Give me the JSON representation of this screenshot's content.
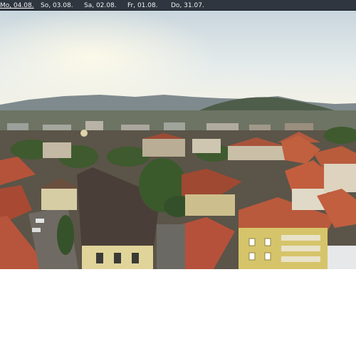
{
  "archive_bar": {
    "days": [
      {
        "label": "Mo, 04.08."
      },
      {
        "label": "So, 03.08."
      },
      {
        "label": "Sa, 02.08."
      },
      {
        "label": "Fr, 01.08."
      },
      {
        "label": "Do, 31.07."
      }
    ]
  },
  "colors": {
    "bar_background": "#2f3640",
    "bar_text": "#f1f1f1",
    "roof_red": "#b5533a",
    "roof_dark": "#4a3f38",
    "facade_yellow": "#d6c46a",
    "sky": "#e8eef0",
    "tree_green": "#3e5a2e"
  }
}
